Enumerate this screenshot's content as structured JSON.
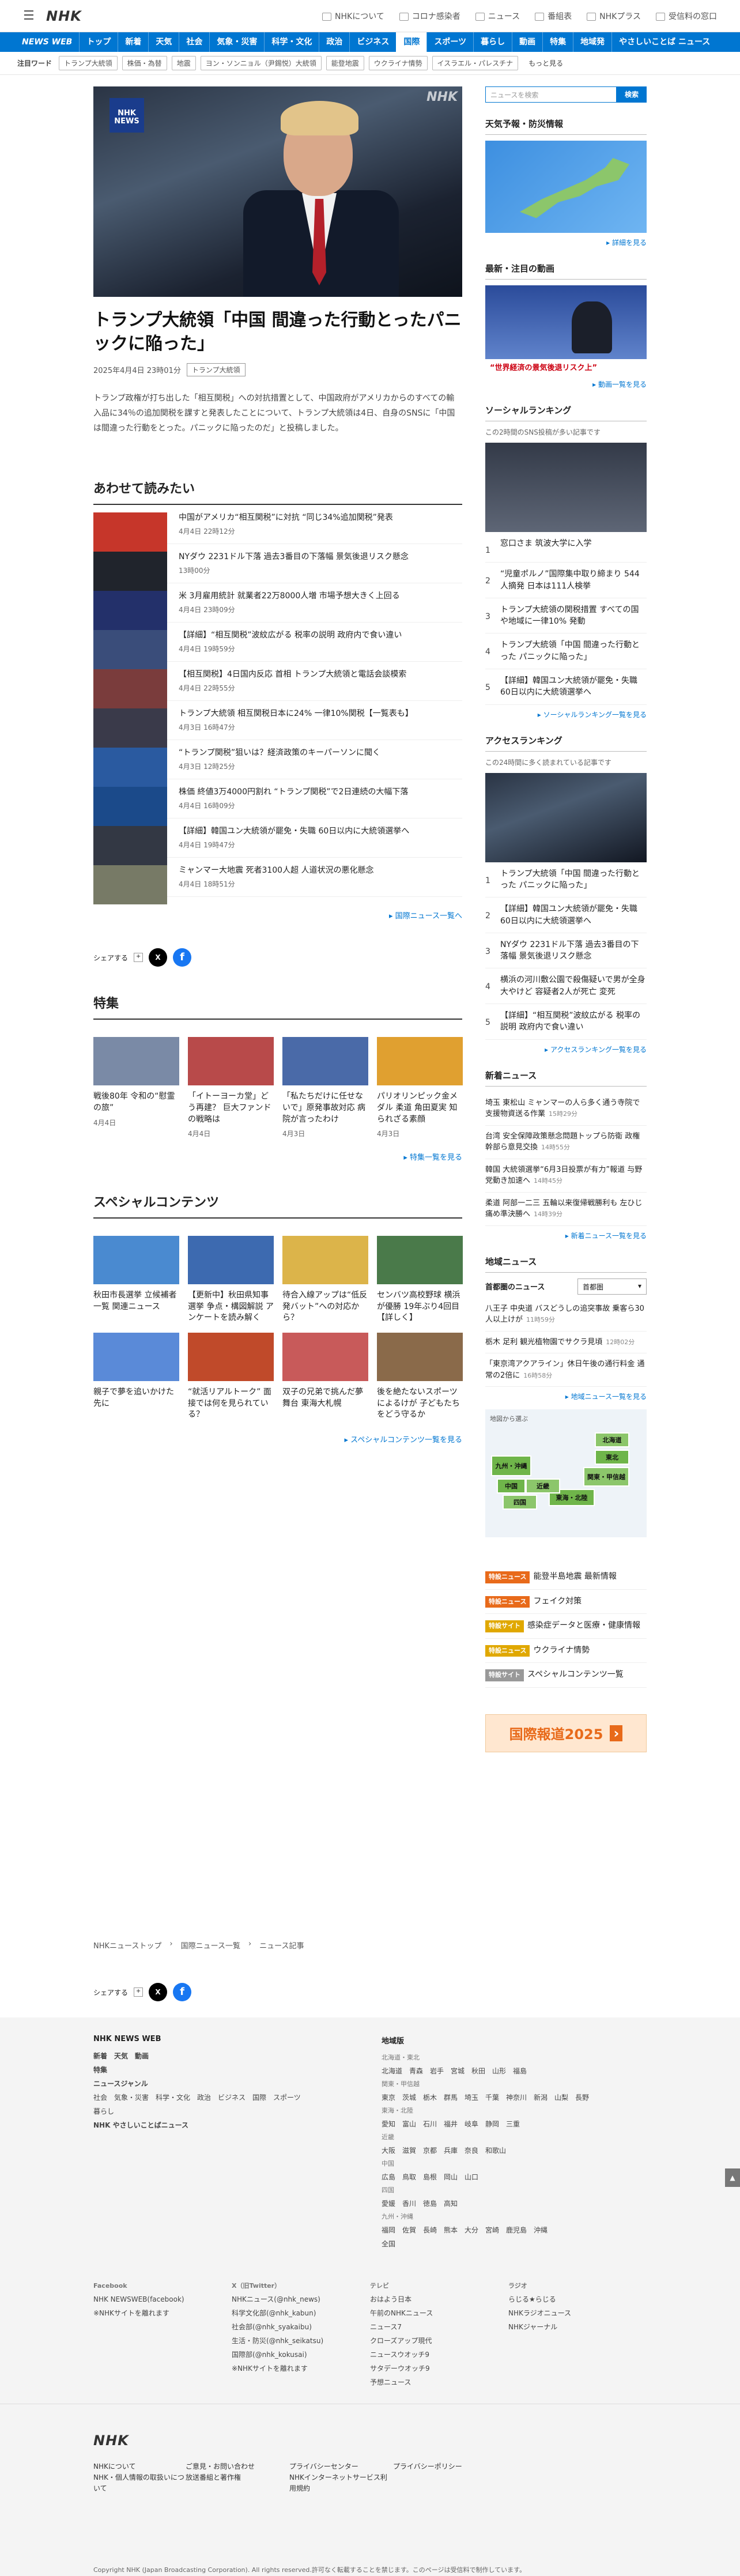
{
  "header": {
    "logo": "NHK",
    "links": [
      "NHKについて",
      "コロナ感染者",
      "ニュース",
      "番組表",
      "NHKプラス",
      "受信料の窓口"
    ]
  },
  "nav": {
    "brand": "NEWS WEB",
    "items": [
      "トップ",
      "新着",
      "天気",
      "社会",
      "気象・災害",
      "科学・文化",
      "政治",
      "ビジネス",
      "国際",
      "スポーツ",
      "暮らし",
      "動画",
      "特集",
      "地域発",
      "やさしいことば ニュース"
    ],
    "active": "国際"
  },
  "tags": {
    "label": "注目ワード",
    "items": [
      "トランプ大統領",
      "株価・為替",
      "地震",
      "ヨン・ソンニョル（尹錫悦）大統領",
      "能登地震",
      "ウクライナ情勢",
      "イスラエル・パレスチナ"
    ],
    "more": "もっと見る"
  },
  "article": {
    "hero_badge": "NHK NEWS",
    "hero_watermark": "NHK",
    "title": "トランプ大統領「中国 間違った行動とったパニックに陥った」",
    "date": "2025年4月4日 23時01分",
    "category": "トランプ大統領",
    "lead": "トランプ政権が打ち出した「相互関税」への対抗措置として、中国政府がアメリカからのすべての輸入品に34％の追加関税を課すと発表したことについて、トランプ大統領は4日、自身のSNSに「中国は間違った行動をとった。パニックに陥ったのだ」と投稿しました。"
  },
  "related": {
    "heading": "あわせて読みたい",
    "items": [
      {
        "title": "中国がアメリカ“相互関税”に対抗 “同じ34%追加関税”発表",
        "date": "4月4日 22時12分"
      },
      {
        "title": "NYダウ 2231ドル下落 過去3番目の下落幅 景気後退リスク懸念",
        "date": "13時00分"
      },
      {
        "title": "米 3月雇用統計 就業者22万8000人増 市場予想大きく上回る",
        "date": "4月4日 23時09分"
      },
      {
        "title": "【詳細】“相互関税”波紋広がる 税率の説明 政府内で食い違い",
        "date": "4月4日 19時59分"
      },
      {
        "title": "【相互関税】4日国内反応 首相 トランプ大統領と電話会談模索",
        "date": "4月4日 22時55分"
      },
      {
        "title": "トランプ大統領 相互関税日本に24% 一律10%関税【一覧表も】",
        "date": "4月3日 16時47分"
      },
      {
        "title": "“トランプ関税”狙いは？経済政策のキーパーソンに聞く",
        "date": "4月3日 12時25分"
      },
      {
        "title": "株価 終値3万4000円割れ “トランプ関税”で2日連続の大幅下落",
        "date": "4月4日 16時09分"
      },
      {
        "title": "【詳細】韓国ユン大統領が罷免・失職 60日以内に大統領選挙へ",
        "date": "4月4日 19時47分"
      },
      {
        "title": "ミャンマー大地震 死者3100人超 人道状況の悪化懸念",
        "date": "4月4日 18時51分"
      }
    ],
    "more": "国際ニュース一覧へ"
  },
  "share": {
    "label": "シェアする"
  },
  "features": {
    "heading": "特集",
    "items": [
      {
        "title": "戦後80年 令和の“慰霊の旅”",
        "date": "4月4日"
      },
      {
        "title": "「イトーヨーカ堂」どう再建？ 巨大ファンドの戦略は",
        "date": "4月4日"
      },
      {
        "title": "「私たちだけに任せないで」原発事故対応 病院が言ったわけ",
        "date": "4月3日"
      },
      {
        "title": "パリオリンピック金メダル 柔道 角田夏実 知られざる素顔",
        "date": "4月3日"
      }
    ],
    "more": "特集一覧を見る"
  },
  "special": {
    "heading": "スペシャルコンテンツ",
    "items": [
      {
        "title": "秋田市長選挙 立候補者一覧 関連ニュース"
      },
      {
        "title": "【更新中】秋田県知事選挙 争点・構図解説 アンケートを読み解く"
      },
      {
        "title": "待合入線アップは“低反発バット”への対応から？"
      },
      {
        "title": "センバツ高校野球 横浜が優勝 19年ぶり4回目【詳しく】"
      },
      {
        "title": "親子で夢を追いかけた先に"
      },
      {
        "title": "“就活リアルトーク” 面接では何を見られている？"
      },
      {
        "title": "双子の兄弟で挑んだ夢舞台 東海大札幌"
      },
      {
        "title": "後を絶たないスポーツによるけが 子どもたちをどう守るか"
      }
    ],
    "more": "スペシャルコンテンツ一覧を見る"
  },
  "sidebar": {
    "search_placeholder": "ニュースを検索",
    "search_button": "検索",
    "weather": {
      "heading": "天気予報・防災情報",
      "more": "詳細を見る"
    },
    "video": {
      "heading": "最新・注目の動画",
      "caption": "“世界経済の景気後退リスク上”",
      "more": "動画一覧を見る"
    },
    "social": {
      "heading": "ソーシャルランキング",
      "note": "この2時間のSNS投稿が多い記事です",
      "items": [
        "窓口さま 筑波大学に入学",
        "“児童ポルノ”国際集中取り締まり 544人摘発 日本は111人検挙",
        "トランプ大統領の関税措置 すべての国や地域に一律10% 発動",
        "トランプ大統領「中国 間違った行動とった パニックに陥った」",
        "【詳細】韓国ユン大統領が罷免・失職 60日以内に大統領選挙へ"
      ],
      "more": "ソーシャルランキング一覧を見る"
    },
    "access": {
      "heading": "アクセスランキング",
      "note": "この24時間に多く読まれている記事です",
      "items": [
        "トランプ大統領「中国 間違った行動とった パニックに陥った」",
        "【詳細】韓国ユン大統領が罷免・失職 60日以内に大統領選挙へ",
        "NYダウ 2231ドル下落 過去3番目の下落幅 景気後退リスク懸念",
        "横浜の河川敷公園で殺傷疑いで男が全身大やけど 容疑者2人が死亡 変死",
        "【詳細】“相互関税”波紋広がる 税率の説明 政府内で食い違い"
      ],
      "more": "アクセスランキング一覧を見る"
    },
    "news": {
      "heading": "新着ニュース",
      "items": [
        {
          "title": "埼玉 東松山 ミャンマーの人ら多く通う寺院で支援物資送る作業",
          "time": "15時29分"
        },
        {
          "title": "台湾 安全保障政策懸念問題トップら防衛 政権幹部ら意見交換",
          "time": "14時55分"
        },
        {
          "title": "韓国 大統領選挙“6月3日投票が有力”報道 与野党動き加速へ",
          "time": "14時45分"
        },
        {
          "title": "柔道 阿部一二三 五輪以来復帰戦勝利も 左ひじ痛め準決勝へ",
          "time": "14時39分"
        }
      ],
      "more": "新着ニュース一覧を見る"
    },
    "regional": {
      "heading": "地域ニュース",
      "area_label": "首都圏のニュース",
      "select": "首都圏",
      "items": [
        {
          "title": "八王子 中央道 バスどうしの追突事故 乗客ら30人以上けが",
          "time": "11時59分"
        },
        {
          "title": "栃木 足利 観光植物園でサクラ見頃",
          "time": "12時02分"
        },
        {
          "title": "「東京湾アクアライン」休日午後の通行料金 通常の2倍に",
          "time": "16時58分"
        }
      ],
      "more": "地域ニュース一覧を見る",
      "map_label": "地図から選ぶ",
      "regions": [
        "北海道",
        "東北",
        "関東・甲信越",
        "東海・北陸",
        "近畿",
        "中国",
        "四国",
        "九州・沖縄"
      ]
    },
    "specials": [
      {
        "label": "特設ニュース",
        "title": "能登半島地震 最新情報",
        "color": "#e86a1a"
      },
      {
        "label": "特設ニュース",
        "title": "フェイク対策",
        "color": "#e86a1a"
      },
      {
        "label": "特設サイト",
        "title": "感染症データと医療・健康情報",
        "color": "#e0a800"
      },
      {
        "label": "特設ニュース",
        "title": "ウクライナ情勢",
        "color": "#e0a800"
      },
      {
        "label": "特設サイト",
        "title": "スペシャルコンテンツ一覧",
        "color": "#999999"
      }
    ],
    "banner": "国際報道2025"
  },
  "breadcrumb": [
    "NHKニューストップ",
    "国際ニュース一覧",
    "ニュース記事"
  ],
  "footer": {
    "col1_title": "NHK NEWS WEB",
    "col1_rows": [
      "新着　天気　動画",
      "特集",
      "ニュースジャンル",
      "社会　気象・災害　科学・文化　政治　ビジネス　国際　スポーツ",
      "暮らし",
      "NHK やさしいことばニュース"
    ],
    "col2_title": "地域版",
    "col2_rows": [
      "北海道・東北",
      "北海道　青森　岩手　宮城　秋田　山形　福島",
      "関東・甲信越",
      "東京　茨城　栃木　群馬　埼玉　千葉　神奈川　新潟　山梨　長野",
      "東海・北陸",
      "愛知　富山　石川　福井　岐阜　静岡　三重",
      "近畿",
      "大阪　滋賀　京都　兵庫　奈良　和歌山",
      "中国",
      "広島　鳥取　島根　岡山　山口",
      "四国",
      "愛媛　香川　徳島　高知",
      "九州・沖縄",
      "福岡　佐賀　長崎　熊本　大分　宮崎　鹿児島　沖縄",
      "全国"
    ],
    "sns": [
      {
        "title": "Facebook",
        "rows": [
          "NHK NEWSWEB(facebook)",
          "※NHKサイトを離れます"
        ]
      },
      {
        "title": "X（旧Twitter）",
        "rows": [
          "NHKニュース(@nhk_news)",
          "科学文化部(@nhk_kabun)",
          "社会部(@nhk_syakaibu)",
          "生活・防災(@nhk_seikatsu)",
          "国際部(@nhk_kokusai)",
          "※NHKサイトを離れます"
        ]
      },
      {
        "title": "テレビ",
        "rows": [
          "おはよう日本",
          "午前のNHKニュース",
          "ニュース7",
          "クローズアップ現代",
          "ニュースウオッチ9",
          "サタデーウオッチ9",
          "予想ニュース"
        ]
      },
      {
        "title": "ラジオ",
        "rows": [
          "らじる★らじる",
          "NHKラジオニュース",
          "NHKジャーナル"
        ]
      }
    ],
    "logo": "NHK",
    "bottom_links": [
      "NHKについて",
      "ご意見・お問い合わせ",
      "プライバシーセンター",
      "プライバシーポリシー",
      "NHK・個人情報の取扱いについて",
      "放送番組と著作権",
      "NHKインターネットサービス利用規約"
    ],
    "copyright": "Copyright NHK (Japan Broadcasting Corporation). All rights reserved.許可なく転載することを禁じます。このページは受信料で制作しています。"
  }
}
